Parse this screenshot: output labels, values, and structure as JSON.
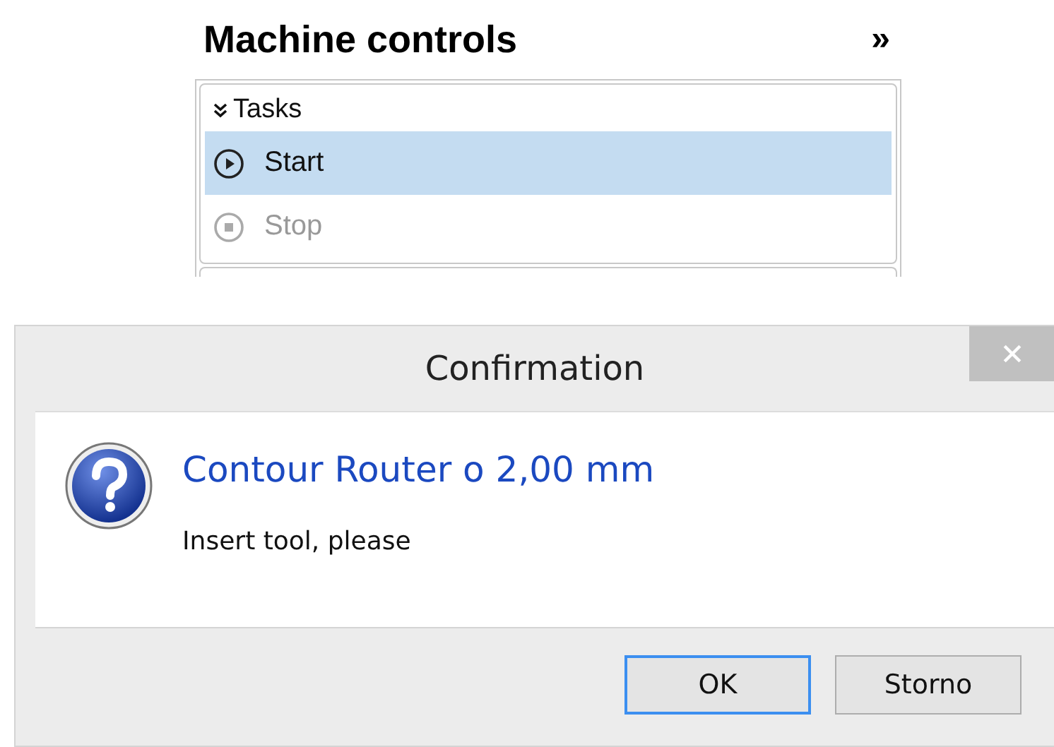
{
  "panel": {
    "title": "Machine controls",
    "collapse_glyph": "»",
    "group": {
      "title": "Tasks",
      "expanded": true,
      "items": [
        {
          "label": "Start",
          "kind": "play",
          "selected": true,
          "disabled": false
        },
        {
          "label": "Stop",
          "kind": "stop",
          "selected": false,
          "disabled": true
        }
      ]
    }
  },
  "dialog": {
    "title": "Confirmation",
    "heading": "Contour Router o 2,00 mm",
    "message": "Insert tool, please",
    "buttons": [
      {
        "label": "OK",
        "default": true
      },
      {
        "label": "Storno",
        "default": false
      }
    ]
  }
}
